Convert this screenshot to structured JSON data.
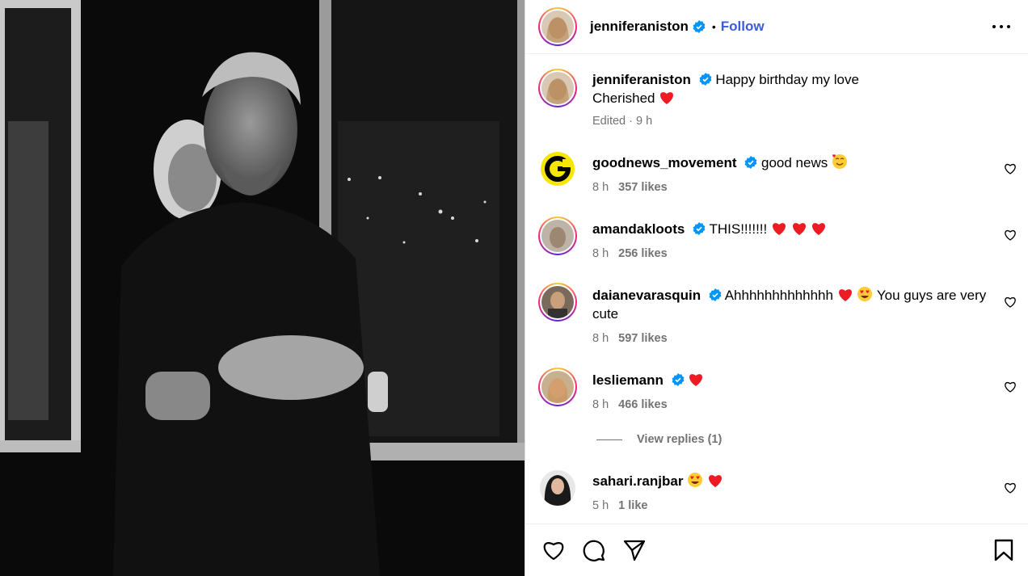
{
  "post": {
    "author": "jenniferaniston",
    "follow_label": "Follow",
    "separator": "•",
    "caption_line1": "Happy birthday my love",
    "caption_line2": "Cherished",
    "caption_meta": "Edited · 9 h"
  },
  "comments": [
    {
      "user": "goodnews_movement",
      "text": "good news",
      "time": "8 h",
      "likes": "357 likes"
    },
    {
      "user": "amandakloots",
      "text": "THIS!!!!!!!",
      "time": "8 h",
      "likes": "256 likes"
    },
    {
      "user": "daianevarasquin",
      "text_a": "Ahhhhhhhhhhhhh",
      "text_b": "You guys are very cute",
      "time": "8 h",
      "likes": "597 likes"
    },
    {
      "user": "lesliemann",
      "time": "8 h",
      "likes": "466 likes"
    },
    {
      "user": "sahari.ranjbar",
      "time": "5 h",
      "likes": "1 like"
    }
  ],
  "view_replies": "View replies (1)",
  "colors": {
    "verified": "#0095f6",
    "heart": "#ed1c24",
    "follow": "#3b5bdb",
    "meta": "#737373"
  },
  "icons": [
    "like-icon",
    "comment-icon",
    "share-icon",
    "save-icon",
    "more-icon",
    "verified-icon"
  ]
}
